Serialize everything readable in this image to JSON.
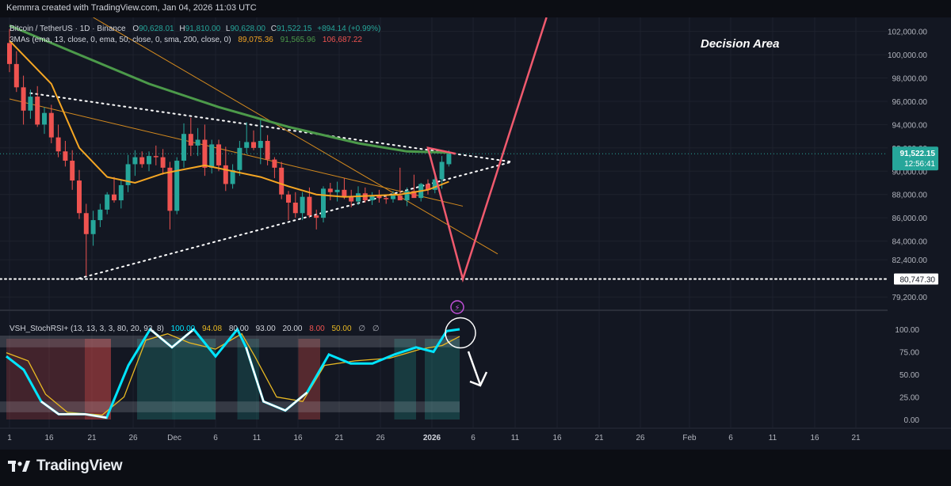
{
  "header": {
    "caption": "Kemmra created with TradingView.com, Jan 04, 2026 11:03 UTC"
  },
  "footer": {
    "brand": "TradingView"
  },
  "legend": {
    "symbol_line": {
      "symbol": "Bitcoin / TetherUS · 1D · Binance",
      "o_label": "O",
      "o": "90,628.01",
      "h_label": "H",
      "h": "91,810.00",
      "l_label": "L",
      "l": "90,628.00",
      "c_label": "C",
      "c": "91,522.15",
      "change": "+894.14 (+0.99%)"
    },
    "ma_line": {
      "label": "3MAs (ema, 13, close, 0, ema, 50, close, 0, sma, 200, close, 0)",
      "v1": "89,075.36",
      "v2": "91,565.96",
      "v3": "106,687.22"
    },
    "osc_line": {
      "label": "VSH_StochRSI+ (13, 13, 3, 3, 80, 20, 93, 8)",
      "v1": "100.00",
      "v2": "94.08",
      "v3": "80.00",
      "v4": "93.00",
      "v5": "20.00",
      "v6": "8.00",
      "v7": "50.00",
      "v8": "∅",
      "v9": "∅"
    }
  },
  "annotation": {
    "decision": "Decision Area"
  },
  "price_axis": {
    "ticks": [
      "102,000.00",
      "100,000.00",
      "98,000.00",
      "96,000.00",
      "94,000.00",
      "92,000.00",
      "90,000.00",
      "88,000.00",
      "86,000.00",
      "84,000.00",
      "82,400.00",
      "79,200.00"
    ],
    "current_price": "91,522.15",
    "countdown": "12:56:41",
    "support_label": "80,747.30"
  },
  "osc_axis": {
    "ticks": [
      "100.00",
      "75.00",
      "50.00",
      "25.00",
      "0.00"
    ]
  },
  "time_axis": {
    "ticks": [
      "1",
      "16",
      "21",
      "26",
      "Dec",
      "6",
      "11",
      "16",
      "21",
      "26",
      "2026",
      "6",
      "11",
      "16",
      "21",
      "26",
      "Feb",
      "6",
      "11",
      "16",
      "21"
    ]
  },
  "colors": {
    "bg": "#131722",
    "up": "#26a69a",
    "down": "#ef5350",
    "ema13": "#f5a623",
    "ema50": "#4c9a4a",
    "projection": "#f05a6e",
    "stoch_k": "#00e5ff",
    "stoch_d": "#e8b923",
    "price_tag": "#26a69a"
  },
  "chart_data": {
    "type": "candlestick",
    "symbol": "Bitcoin / TetherUS",
    "timeframe": "1D",
    "ylim": [
      78400,
      103200
    ],
    "candles_ohlc": [
      [
        101000,
        102200,
        98500,
        99200
      ],
      [
        99200,
        100300,
        96800,
        97200
      ],
      [
        97200,
        98200,
        94000,
        95200
      ],
      [
        95200,
        97000,
        94500,
        96400
      ],
      [
        96400,
        97300,
        93800,
        94000
      ],
      [
        94000,
        95500,
        93200,
        95000
      ],
      [
        95000,
        95700,
        92400,
        92900
      ],
      [
        92900,
        94000,
        91200,
        91700
      ],
      [
        91700,
        92600,
        90400,
        90900
      ],
      [
        90900,
        91800,
        88400,
        89200
      ],
      [
        89200,
        90100,
        85900,
        86400
      ],
      [
        86400,
        87200,
        81000,
        84600
      ],
      [
        84600,
        86600,
        83600,
        85800
      ],
      [
        85800,
        87200,
        85200,
        86700
      ],
      [
        86700,
        88200,
        86300,
        88000
      ],
      [
        88000,
        89500,
        87300,
        87500
      ],
      [
        87500,
        89200,
        86800,
        88800
      ],
      [
        88800,
        91400,
        88200,
        90600
      ],
      [
        90600,
        91800,
        89600,
        91200
      ],
      [
        91200,
        91700,
        90300,
        90600
      ],
      [
        90600,
        91700,
        90000,
        91300
      ],
      [
        91300,
        92200,
        90500,
        91200
      ],
      [
        91200,
        91900,
        89700,
        90300
      ],
      [
        90300,
        90800,
        85000,
        86600
      ],
      [
        86600,
        91200,
        86300,
        90900
      ],
      [
        90900,
        94100,
        90300,
        93200
      ],
      [
        93200,
        94600,
        91300,
        92200
      ],
      [
        92200,
        93700,
        91300,
        92700
      ],
      [
        92700,
        94000,
        89600,
        90300
      ],
      [
        90300,
        92700,
        89800,
        92300
      ],
      [
        92300,
        92700,
        90000,
        90500
      ],
      [
        90500,
        92100,
        88300,
        88900
      ],
      [
        88900,
        90600,
        88500,
        90100
      ],
      [
        90100,
        92600,
        89600,
        92000
      ],
      [
        92000,
        94200,
        91500,
        92500
      ],
      [
        92500,
        93500,
        91800,
        92000
      ],
      [
        92000,
        94400,
        90600,
        92600
      ],
      [
        92600,
        93100,
        90500,
        91000
      ],
      [
        91000,
        91200,
        89400,
        90300
      ],
      [
        90300,
        90800,
        87600,
        88000
      ],
      [
        88000,
        88300,
        85800,
        87300
      ],
      [
        87300,
        88200,
        86000,
        86400
      ],
      [
        86400,
        88200,
        85800,
        87800
      ],
      [
        87800,
        88600,
        86000,
        86200
      ],
      [
        86200,
        86700,
        85000,
        86000
      ],
      [
        86000,
        88700,
        85600,
        88500
      ],
      [
        88500,
        89000,
        87500,
        88200
      ],
      [
        88200,
        89100,
        87400,
        88400
      ],
      [
        88400,
        89400,
        87600,
        87800
      ],
      [
        87800,
        88400,
        86900,
        87400
      ],
      [
        87400,
        88700,
        87100,
        88100
      ],
      [
        88100,
        88600,
        87300,
        87500
      ],
      [
        87500,
        88200,
        87100,
        87900
      ],
      [
        87900,
        88400,
        87300,
        87700
      ],
      [
        87700,
        88000,
        87200,
        87600
      ],
      [
        87600,
        88300,
        87300,
        87900
      ],
      [
        87900,
        90300,
        87600,
        87500
      ],
      [
        87500,
        88600,
        87000,
        88300
      ],
      [
        88300,
        89700,
        88000,
        87700
      ],
      [
        87700,
        89000,
        87400,
        88900
      ],
      [
        88900,
        89300,
        88000,
        88400
      ],
      [
        88400,
        89600,
        88100,
        89300
      ],
      [
        89300,
        91300,
        88500,
        90800
      ],
      [
        90600,
        91800,
        90400,
        91500
      ]
    ],
    "ema13": [
      [
        0,
        101200
      ],
      [
        6,
        97500
      ],
      [
        10,
        92000
      ],
      [
        14,
        89500
      ],
      [
        18,
        89000
      ],
      [
        22,
        89800
      ],
      [
        28,
        90500
      ],
      [
        32,
        90000
      ],
      [
        36,
        89500
      ],
      [
        40,
        88700
      ],
      [
        44,
        88000
      ],
      [
        48,
        87800
      ],
      [
        52,
        87900
      ],
      [
        56,
        88000
      ],
      [
        60,
        88400
      ],
      [
        63,
        89100
      ]
    ],
    "ema50": [
      [
        0,
        102500
      ],
      [
        10,
        100000
      ],
      [
        20,
        97500
      ],
      [
        30,
        95500
      ],
      [
        40,
        93800
      ],
      [
        50,
        92400
      ],
      [
        57,
        91700
      ],
      [
        63,
        91600
      ]
    ],
    "resistance_line": [
      [
        3,
        96700
      ],
      [
        72,
        90800
      ]
    ],
    "support_line": [
      [
        10,
        80800
      ],
      [
        72,
        90800
      ]
    ],
    "support_level": 80747.3,
    "thin_trendlines": [
      [
        [
          0,
          96200
        ],
        [
          65,
          87000
        ]
      ],
      [
        [
          12,
          103200
        ],
        [
          70,
          82900
        ]
      ]
    ],
    "projection_path": [
      [
        64,
        91500
      ],
      [
        60,
        92000
      ],
      [
        65,
        80747
      ],
      [
        77,
        103200
      ]
    ],
    "stoch_rsi": {
      "k": [
        [
          0,
          70
        ],
        [
          4,
          55
        ],
        [
          8,
          20
        ],
        [
          12,
          6
        ],
        [
          18,
          6
        ],
        [
          23,
          2
        ],
        [
          28,
          60
        ],
        [
          33,
          100
        ],
        [
          38,
          80
        ],
        [
          43,
          100
        ],
        [
          48,
          70
        ],
        [
          53,
          100
        ],
        [
          55,
          80
        ],
        [
          59,
          20
        ],
        [
          64,
          10
        ],
        [
          69,
          30
        ],
        [
          74,
          72
        ],
        [
          79,
          62
        ],
        [
          84,
          62
        ],
        [
          89,
          72
        ],
        [
          94,
          80
        ],
        [
          98,
          75
        ],
        [
          101,
          98
        ],
        [
          104,
          100
        ]
      ],
      "d": [
        [
          0,
          74
        ],
        [
          5,
          65
        ],
        [
          9,
          28
        ],
        [
          14,
          8
        ],
        [
          22,
          5
        ],
        [
          27,
          25
        ],
        [
          32,
          88
        ],
        [
          37,
          95
        ],
        [
          42,
          85
        ],
        [
          48,
          78
        ],
        [
          54,
          95
        ],
        [
          57,
          70
        ],
        [
          62,
          25
        ],
        [
          68,
          20
        ],
        [
          73,
          60
        ],
        [
          80,
          65
        ],
        [
          88,
          68
        ],
        [
          95,
          78
        ],
        [
          100,
          82
        ],
        [
          104,
          92
        ]
      ],
      "levels": [
        100,
        80,
        50,
        20,
        0
      ],
      "bands": [
        [
          80,
          93
        ],
        [
          8,
          20
        ]
      ]
    }
  }
}
